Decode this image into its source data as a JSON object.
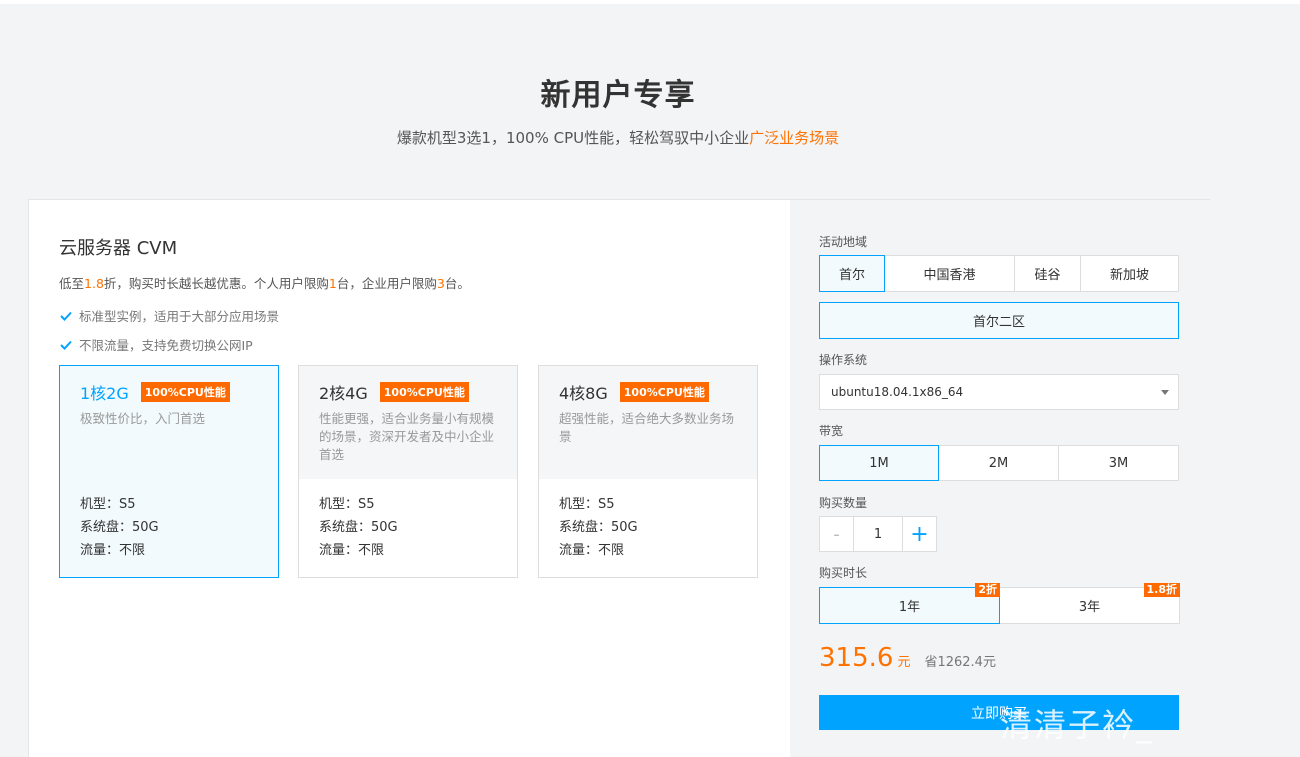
{
  "hero": {
    "title": "新用户专享",
    "subtitle_main": "爆款机型3选1，100% CPU性能，轻松驾驭中小企业",
    "subtitle_highlight": "广泛业务场景"
  },
  "product": {
    "title": "云服务器 CVM",
    "desc_prefix": "低至",
    "desc_discount": "1.8",
    "desc_mid": "折，购买时长越长越优惠。个人用户限购",
    "desc_personal": "1",
    "desc_mid2": "台，企业用户限购",
    "desc_enterprise": "3",
    "desc_suffix": "台。",
    "features": [
      "标准型实例，适用于大部分应用场景",
      "不限流量，支持免费切换公网IP"
    ]
  },
  "specs": [
    {
      "name": "1核2G",
      "badge": "100%CPU性能",
      "desc": "极致性价比，入门首选",
      "model": "机型：S5",
      "disk": "系统盘：50G",
      "traffic": "流量：不限",
      "selected": true
    },
    {
      "name": "2核4G",
      "badge": "100%CPU性能",
      "desc": "性能更强，适合业务量小有规模的场景，资深开发者及中小企业首选",
      "model": "机型：S5",
      "disk": "系统盘：50G",
      "traffic": "流量：不限",
      "selected": false
    },
    {
      "name": "4核8G",
      "badge": "100%CPU性能",
      "desc": "超强性能，适合绝大多数业务场景",
      "model": "机型：S5",
      "disk": "系统盘：50G",
      "traffic": "流量：不限",
      "selected": false
    }
  ],
  "config": {
    "region_label": "活动地域",
    "regions": [
      "首尔",
      "中国香港",
      "硅谷",
      "新加坡"
    ],
    "selected_region": "首尔",
    "zone": "首尔二区",
    "os_label": "操作系统",
    "os_value": "ubuntu18.04.1x86_64",
    "bandwidth_label": "带宽",
    "bandwidths": [
      "1M",
      "2M",
      "3M"
    ],
    "selected_bandwidth": "1M",
    "qty_label": "购买数量",
    "qty_minus": "-",
    "qty_value": "1",
    "qty_plus": "+",
    "duration_label": "购买时长",
    "durations": [
      {
        "label": "1年",
        "discount": "2折",
        "selected": true
      },
      {
        "label": "3年",
        "discount": "1.8折",
        "selected": false
      }
    ],
    "price": "315.6",
    "price_unit": "元",
    "save_text": "省1262.4元",
    "buy_label": "立即购买"
  },
  "watermark": "清清子衿_",
  "colors": {
    "accent": "#00a4ff",
    "orange": "#ff7200",
    "badge": "#ff6a00"
  }
}
